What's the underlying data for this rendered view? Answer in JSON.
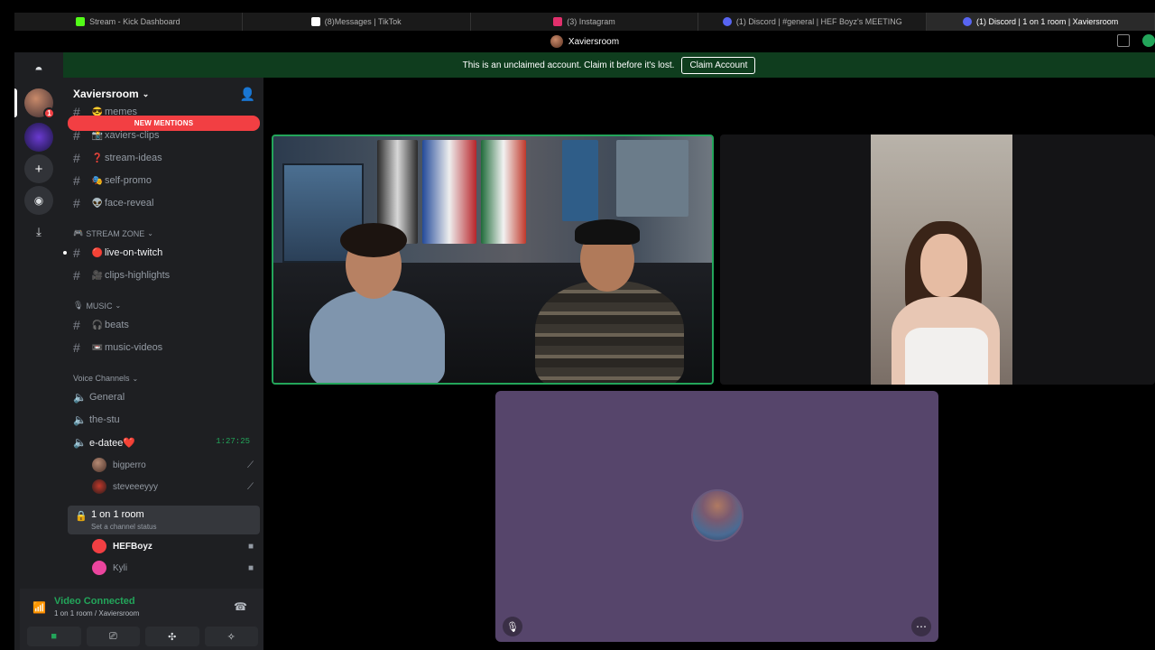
{
  "browser": {
    "tabs": [
      {
        "label": "Stream - Kick Dashboard",
        "color": "#53fc18"
      },
      {
        "label": "(8)Messages | TikTok",
        "color": "#ffffff"
      },
      {
        "label": "(3) Instagram",
        "color": "#e1306c"
      },
      {
        "label": "(1) Discord | #general | HEF Boyz's MEETING",
        "color": "#5865f2"
      },
      {
        "label": "(1) Discord | 1 on 1 room | Xaviersroom",
        "color": "#5865f2"
      }
    ],
    "window_title": "Xaviersroom"
  },
  "banner": {
    "text": "This is an unclaimed account. Claim it before it's lost.",
    "button": "Claim Account"
  },
  "rail": {
    "badge": "1"
  },
  "sidebar": {
    "server_name": "Xaviersroom",
    "new_mentions": "NEW MENTIONS",
    "channels_top": [
      {
        "name": "memes",
        "emoji": "😎"
      },
      {
        "name": "xaviers-clips",
        "emoji": "📸"
      },
      {
        "name": "stream-ideas",
        "emoji": "❓"
      },
      {
        "name": "self-promo",
        "emoji": "🎭"
      },
      {
        "name": "face-reveal",
        "emoji": "👽"
      }
    ],
    "stream_zone": {
      "label": "STREAM ZONE",
      "emoji": "🎮",
      "channels": [
        {
          "name": "live-on-twitch",
          "emoji": "🔴"
        },
        {
          "name": "clips-highlights",
          "emoji": "🎥"
        }
      ]
    },
    "music": {
      "label": "MUSIC",
      "emoji": "🎙",
      "channels": [
        {
          "name": "beats",
          "emoji": "🎧"
        },
        {
          "name": "music-videos",
          "emoji": "📼"
        }
      ]
    },
    "voice": {
      "label": "Voice Channels",
      "channels": [
        {
          "name": "General"
        },
        {
          "name": "the-stu"
        },
        {
          "name": "e-datee❤️",
          "timer": "1:27:25"
        }
      ],
      "edatee_users": [
        {
          "name": "bigperro"
        },
        {
          "name": "steveeeyyy"
        }
      ],
      "room": {
        "name": "1 on 1 room",
        "status": "Set a channel status"
      },
      "room_users": [
        {
          "name": "HEFBoyz"
        },
        {
          "name": "Kyli"
        }
      ]
    }
  },
  "voice_panel": {
    "title": "Video Connected",
    "subtitle": "1 on 1 room / Xaviersroom"
  },
  "colors": {
    "accent_green": "#23a55a",
    "mention_red": "#f23f43",
    "tile_purple": "#56456b"
  }
}
